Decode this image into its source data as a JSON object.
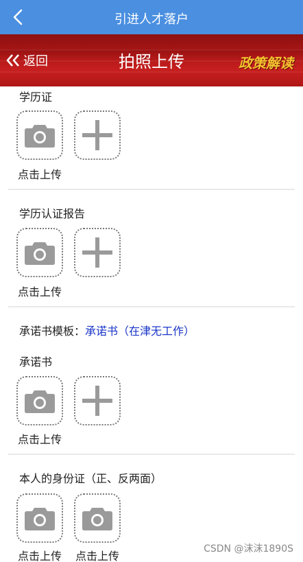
{
  "topbar": {
    "title": "引进人才落户"
  },
  "header": {
    "back_label": "返回",
    "page_title": "拍照上传",
    "policy_label": "政策解读"
  },
  "sections": [
    {
      "label": "学历证",
      "upload_caption": "点击上传"
    },
    {
      "label": "学历认证报告",
      "upload_caption": "点击上传"
    },
    {
      "template_label": "承诺书模板：",
      "template_link": "承诺书（在津无工作）"
    },
    {
      "label": "承诺书",
      "upload_caption": "点击上传"
    },
    {
      "label": "本人的身份证（正、反两面）",
      "upload_caption_front": "点击上传",
      "upload_caption_back": "点击上传"
    }
  ],
  "watermark": "CSDN @沫沫1890S",
  "colors": {
    "topbar": "#4a8fe0",
    "header": "#b81a1a",
    "link": "#1a35c8",
    "policy": "#f4c430"
  }
}
